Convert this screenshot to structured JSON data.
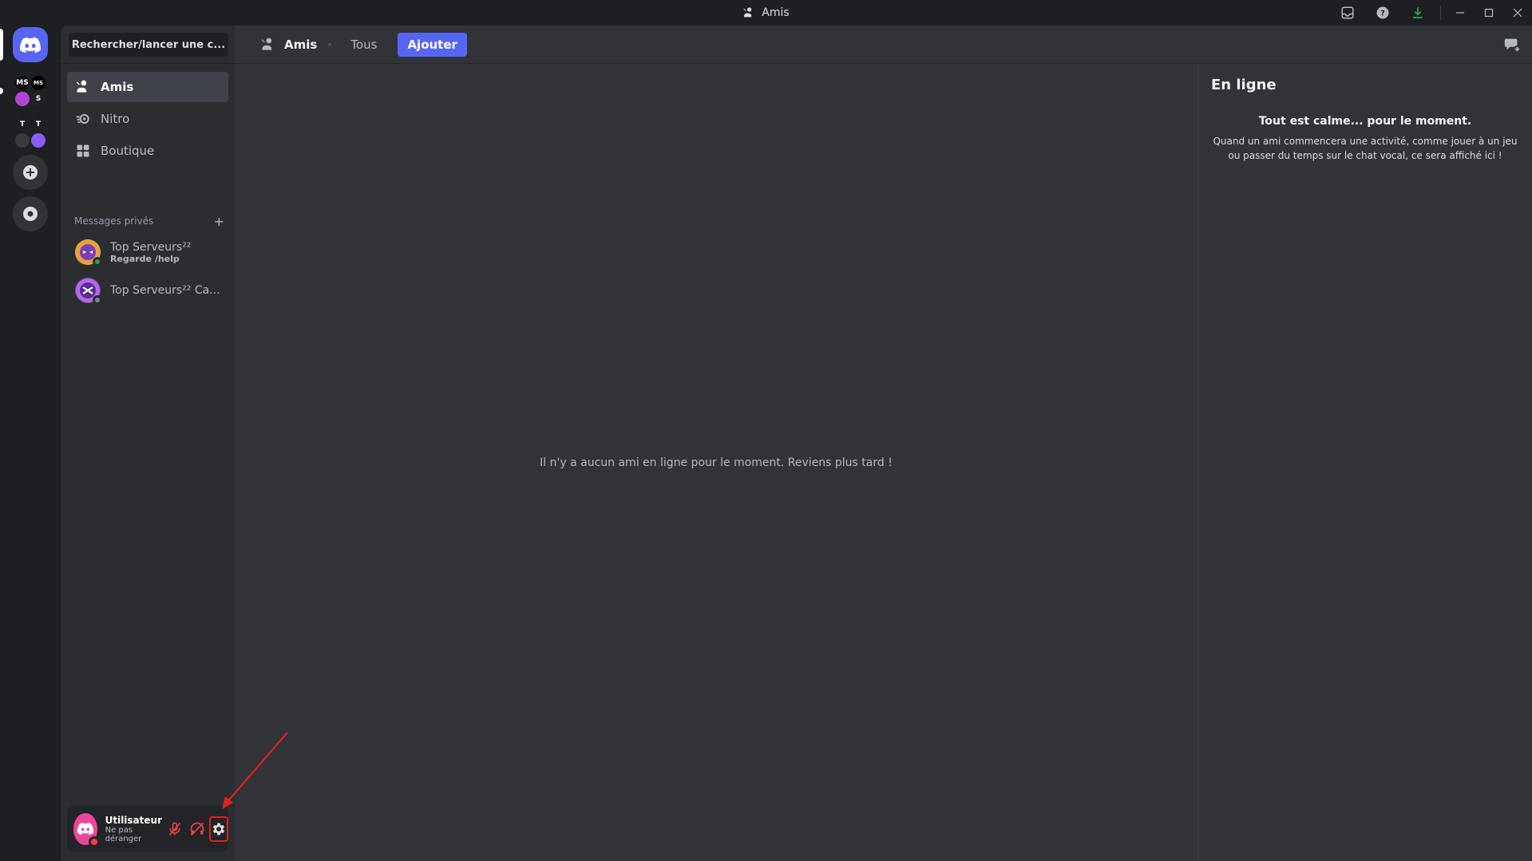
{
  "window": {
    "title": "Amis"
  },
  "sidebar": {
    "search_label": "Rechercher/lancer une c...",
    "nav": [
      {
        "label": "Amis",
        "icon": "friends-icon"
      },
      {
        "label": "Nitro",
        "icon": "nitro-icon"
      },
      {
        "label": "Boutique",
        "icon": "shop-icon"
      }
    ],
    "dm_header": "Messages privés",
    "dms": [
      {
        "name": "Top Serveurs²²",
        "sub": "Regarde /help",
        "status_color": "#23a55a"
      },
      {
        "name": "Top Serveurs²² Ca...",
        "sub": "",
        "status_color": "#80848e"
      }
    ]
  },
  "rail": {
    "folder1": [
      "MS",
      "MS",
      "",
      "S"
    ],
    "folder2": [
      "T",
      "T",
      "",
      ""
    ]
  },
  "user": {
    "name": "Utilisateur",
    "status": "Ne pas déranger"
  },
  "topbar": {
    "title": "Amis",
    "tab_all": "Tous",
    "tab_add": "Ajouter"
  },
  "main": {
    "empty_message": "Il n'y a aucun ami en ligne pour le moment. Reviens plus tard !"
  },
  "activity": {
    "heading": "En ligne",
    "calm_title": "Tout est calme... pour le moment.",
    "calm_text": "Quand un ami commencera une activité, comme jouer à un jeu ou passer du temps sur le chat vocal, ce sera affiché ici !"
  },
  "colors": {
    "accent": "#5865f2",
    "dnd": "#f23f43",
    "online": "#23a55a",
    "annotation": "#e0201b"
  }
}
